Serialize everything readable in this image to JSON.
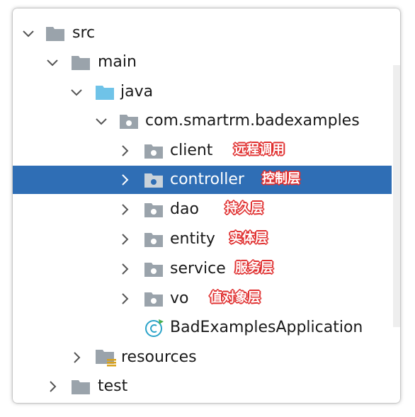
{
  "tree": {
    "items": [
      {
        "label": "src",
        "expanded": true,
        "icon": "folder-icon"
      },
      {
        "label": "main",
        "expanded": true,
        "icon": "folder-icon"
      },
      {
        "label": "java",
        "expanded": true,
        "icon": "source-root-folder-icon"
      },
      {
        "label": "com.smartrm.badexamples",
        "expanded": true,
        "icon": "package-icon"
      },
      {
        "label": "client",
        "expanded": false,
        "icon": "package-icon",
        "annotation": "远程调用"
      },
      {
        "label": "controller",
        "expanded": false,
        "icon": "package-icon",
        "annotation": "控制层",
        "selected": true
      },
      {
        "label": "dao",
        "expanded": false,
        "icon": "package-icon",
        "annotation": "持久层"
      },
      {
        "label": "entity",
        "expanded": false,
        "icon": "package-icon",
        "annotation": "实体层"
      },
      {
        "label": "service",
        "expanded": false,
        "icon": "package-icon",
        "annotation": "服务层"
      },
      {
        "label": "vo",
        "expanded": false,
        "icon": "package-icon",
        "annotation": "值对象层"
      },
      {
        "label": "BadExamplesApplication",
        "icon": "spring-boot-class-icon"
      },
      {
        "label": "resources",
        "expanded": false,
        "icon": "resources-folder-icon"
      },
      {
        "label": "test",
        "expanded": false,
        "icon": "folder-icon"
      }
    ]
  },
  "colors": {
    "selection": "#2f6eb5",
    "annotation": "#e03030",
    "folder": "#9aa3ab",
    "source_folder": "#6fc3e8",
    "class_icon": "#2aa3c9"
  }
}
